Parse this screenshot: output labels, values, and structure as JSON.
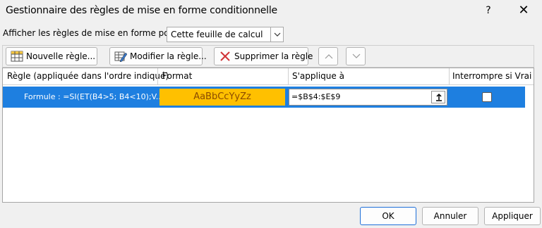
{
  "window": {
    "title": "Gestionnaire des règles de mise en forme conditionnelle",
    "help_label": "?",
    "close_label": "✕"
  },
  "show_rules": {
    "label": "Afficher les règles de mise en forme pour :",
    "selected": "Cette feuille de calcul"
  },
  "toolbar": {
    "new_rule": "Nouvelle règle...",
    "edit_rule": "Modifier la règle...",
    "delete_rule": "Supprimer la règle"
  },
  "grid": {
    "columns": [
      "Règle (appliquée dans l'ordre indiqué)",
      "Format",
      "S'applique à",
      "Interrompre si Vrai"
    ],
    "rows": [
      {
        "rule": "Formule : =SI(ET(B4>5; B4<10);V...",
        "format_preview": "AaBbCcYyZz",
        "applies_to": "=$B$4:$E$9",
        "stop_if_true": false
      }
    ]
  },
  "footer": {
    "ok": "OK",
    "cancel": "Annuler",
    "apply": "Appliquer"
  },
  "colors": {
    "selection": "#1e7fe0",
    "format_fill": "#ffc000"
  }
}
